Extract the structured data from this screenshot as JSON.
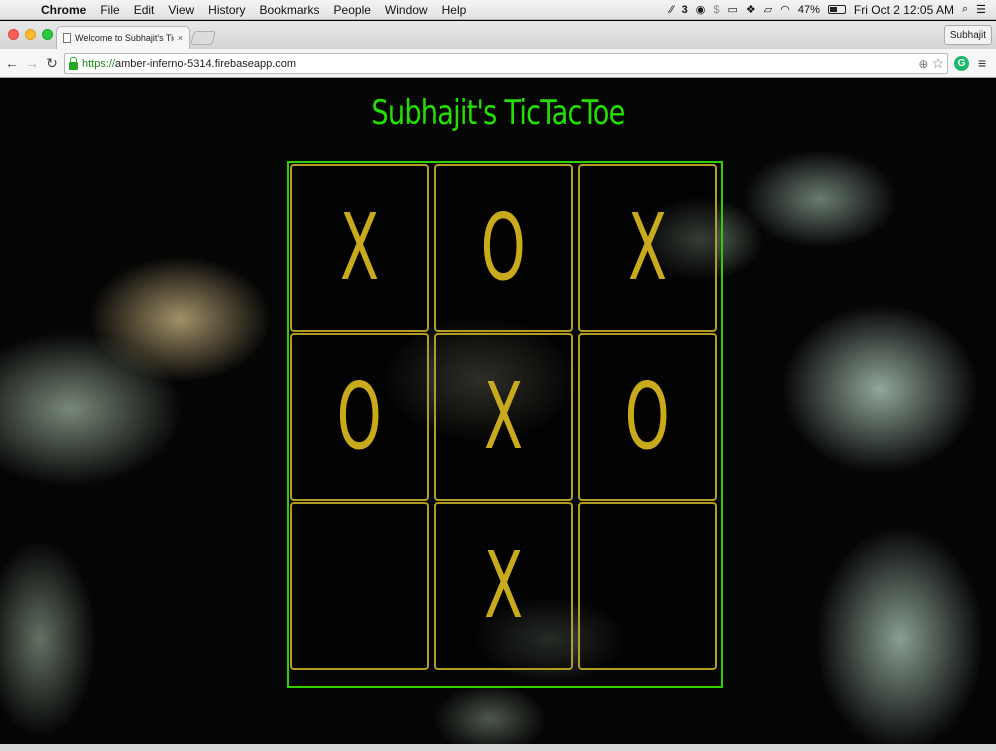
{
  "menubar": {
    "app": "Chrome",
    "items": [
      "File",
      "Edit",
      "View",
      "History",
      "Bookmarks",
      "People",
      "Window",
      "Help"
    ],
    "status": {
      "badge_count": "3",
      "battery": "47%",
      "datetime": "Fri Oct 2  12:05 AM"
    }
  },
  "browser": {
    "tab_title": "Welcome to Subhajit's TicTa",
    "tab_close": "×",
    "profile": "Subhajit",
    "url_scheme": "https://",
    "url_host": "amber-inferno-5314.firebaseapp.com",
    "extension_letter": "G"
  },
  "page": {
    "title": "Subhajit's  TicTacToe",
    "board": [
      "X",
      "O",
      "X",
      "O",
      "X",
      "O",
      "",
      "X",
      ""
    ]
  },
  "colors": {
    "title": "#22e000",
    "board_border": "#2ed100",
    "cell_border": "#b39c22",
    "mark": "#c8aa1c"
  }
}
